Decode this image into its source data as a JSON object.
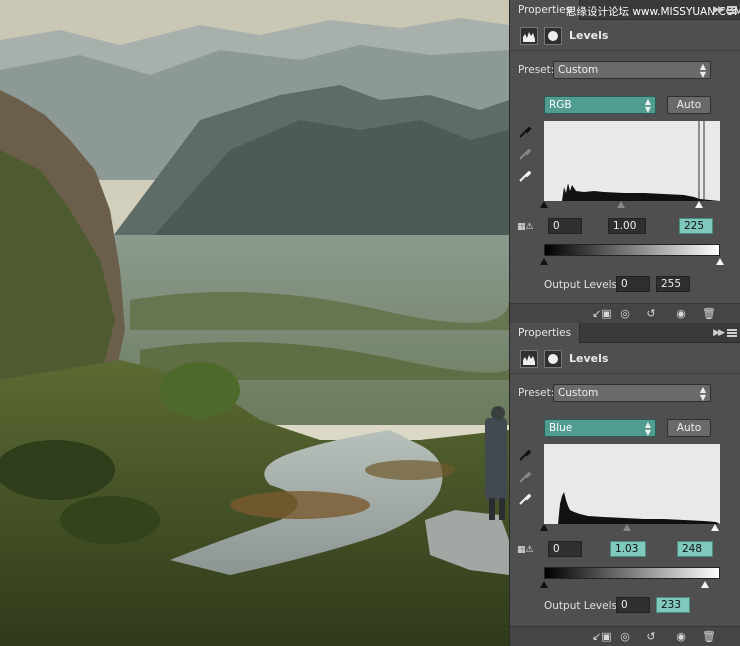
{
  "watermark": "思缘设计论坛  www.MISSYUAN.COM",
  "panels": [
    {
      "tab": "Properties",
      "title": "Levels",
      "preset_label": "Preset:",
      "preset_value": "Custom",
      "channel": "RGB",
      "auto_label": "Auto",
      "input_black": "0",
      "input_gamma": "1.00",
      "input_white": "225",
      "output_label": "Output Levels:",
      "output_black": "0",
      "output_white": "255",
      "input_levels_fraction": {
        "black": 0.0,
        "gamma": 0.44,
        "white": 0.882
      },
      "output_levels_fraction": {
        "black": 0.0,
        "white": 1.0
      }
    },
    {
      "tab": "Properties",
      "title": "Levels",
      "preset_label": "Preset:",
      "preset_value": "Custom",
      "channel": "Blue",
      "auto_label": "Auto",
      "input_black": "0",
      "input_gamma": "1.03",
      "input_white": "248",
      "output_label": "Output Levels:",
      "output_black": "0",
      "output_white": "233",
      "input_levels_fraction": {
        "black": 0.0,
        "gamma": 0.47,
        "white": 0.973
      },
      "output_levels_fraction": {
        "black": 0.0,
        "white": 0.914
      }
    }
  ],
  "icons": {
    "collapse": "double-chevron-right-icon",
    "menu": "panel-menu-icon",
    "levels": "levels-histogram-icon",
    "mask": "layer-mask-icon",
    "eyedroppers": [
      "black-point-eyedropper-icon",
      "gray-point-eyedropper-icon",
      "white-point-eyedropper-icon"
    ],
    "bottom": [
      "clip-to-layer-icon",
      "view-previous-state-icon",
      "reset-icon",
      "visibility-eye-icon",
      "trash-icon"
    ]
  },
  "colors": {
    "channel_bg": "#519c91",
    "highlight_field": "#7ec8bc",
    "panel_bg": "#4f4f4f"
  }
}
